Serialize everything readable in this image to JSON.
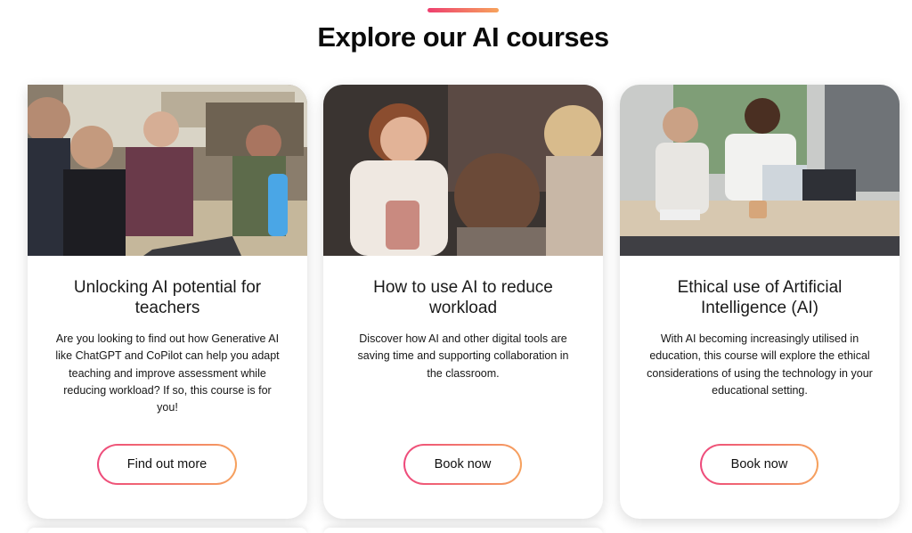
{
  "section": {
    "title": "Explore our AI courses"
  },
  "theme": {
    "accent_start": "#ee3f6f",
    "accent_end": "#f7a35c"
  },
  "courses": [
    {
      "image": "teachers-at-laptop-photo",
      "title": "Unlocking AI potential for teachers",
      "description": "Are you looking to find out how Generative AI like ChatGPT and CoPilot can help you adapt teaching and improve assessment while reducing workload? If so, this course is for you!",
      "cta_label": "Find out more"
    },
    {
      "image": "laughing-teacher-photo",
      "title": "How to use AI to reduce workload",
      "description": "Discover how AI and other digital tools are saving time and supporting collaboration in the classroom.",
      "cta_label": "Book now"
    },
    {
      "image": "colleagues-working-photo",
      "title": "Ethical use of Artificial Intelligence (AI)",
      "description": "With AI becoming increasingly utilised in education, this course will explore the ethical considerations of using the technology in your educational setting.",
      "cta_label": "Book now"
    }
  ]
}
